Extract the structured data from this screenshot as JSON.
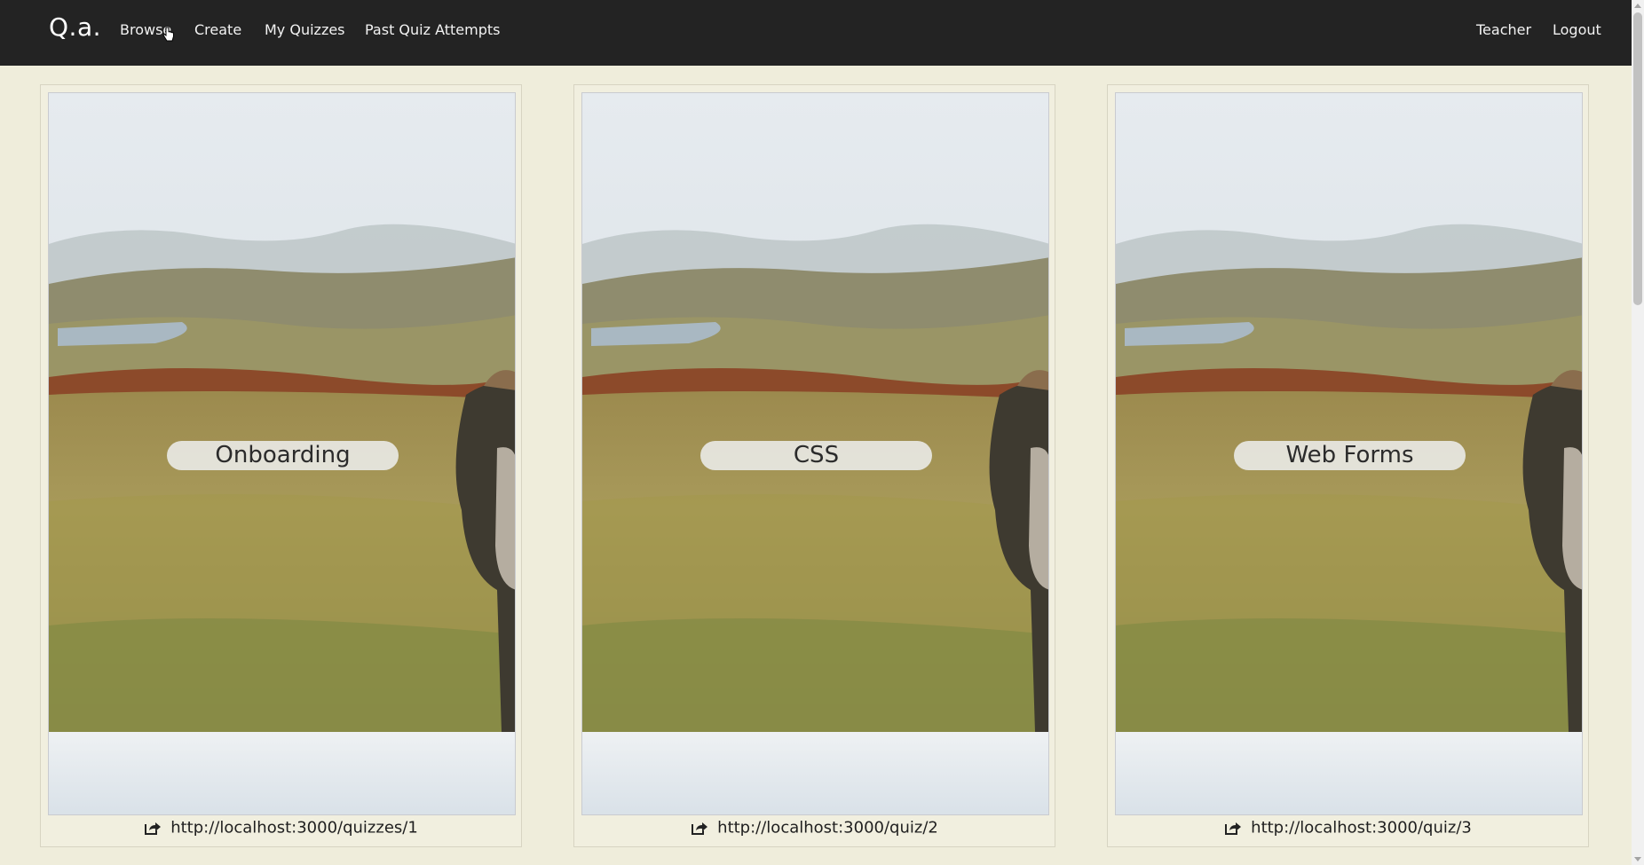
{
  "navbar": {
    "brand": "Q.a.",
    "links": [
      {
        "label": "Browse"
      },
      {
        "label": "Create"
      },
      {
        "label": "My Quizzes"
      },
      {
        "label": "Past Quiz Attempts"
      }
    ],
    "right": {
      "user": "Teacher",
      "logout": "Logout"
    }
  },
  "quizzes": [
    {
      "title": "Onboarding",
      "link": "http://localhost:3000/quizzes/1"
    },
    {
      "title": "CSS",
      "link": "http://localhost:3000/quiz/2"
    },
    {
      "title": "Web Forms",
      "link": "http://localhost:3000/quiz/3"
    }
  ],
  "icons": {
    "share": "share-icon",
    "cursor": "hand-pointer-icon"
  },
  "colors": {
    "navbar_bg": "#232323",
    "page_bg": "#efeddb"
  }
}
